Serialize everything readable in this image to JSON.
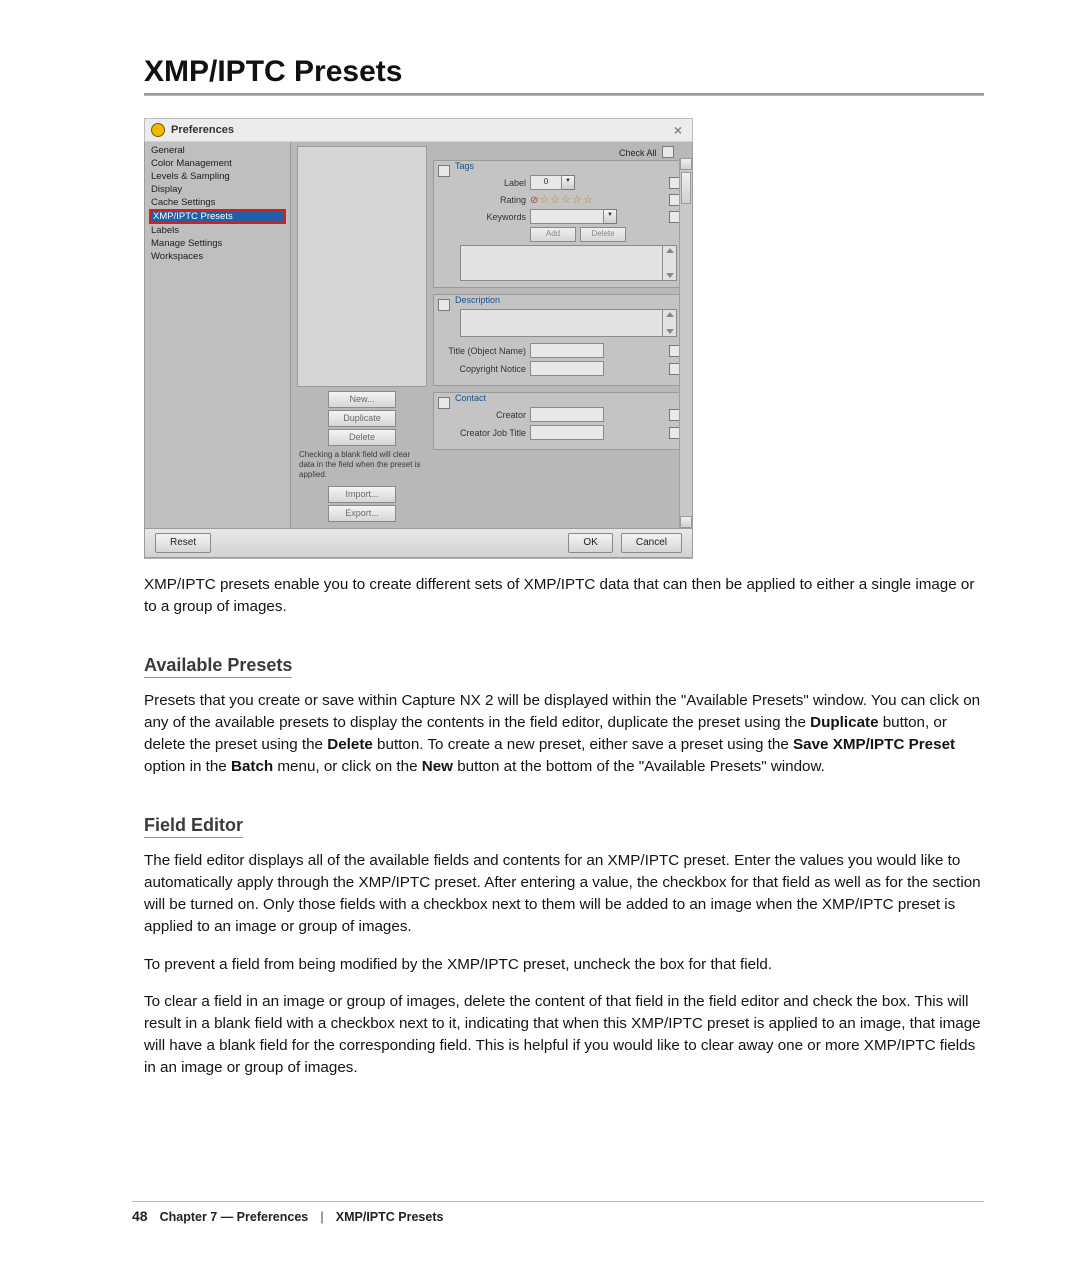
{
  "title": "XMP/IPTC Presets",
  "window": {
    "title": "Preferences",
    "close_x": "×",
    "check_all": "Check All",
    "footer": {
      "reset": "Reset",
      "ok": "OK",
      "cancel": "Cancel"
    }
  },
  "sidebar": {
    "items": [
      {
        "label": "General"
      },
      {
        "label": "Color Management"
      },
      {
        "label": "Levels & Sampling"
      },
      {
        "label": "Display"
      },
      {
        "label": "Cache Settings"
      },
      {
        "label": "XMP/IPTC Presets",
        "selected": true
      },
      {
        "label": "Labels"
      },
      {
        "label": "Manage Settings"
      },
      {
        "label": "Workspaces"
      }
    ]
  },
  "left_buttons": {
    "new": "New...",
    "duplicate": "Duplicate",
    "delete": "Delete",
    "hint": "Checking a blank field will clear data in the field when the preset is applied.",
    "import": "Import...",
    "export": "Export..."
  },
  "panels": {
    "tags": {
      "title": "Tags",
      "label_label": "Label",
      "label_value": "0",
      "rating_label": "Rating",
      "stars": "☆☆☆☆☆",
      "no_rating": "⊘",
      "keywords_label": "Keywords",
      "add_btn": "Add",
      "delete_btn": "Delete"
    },
    "description": {
      "title": "Description",
      "title_field": "Title (Object Name)",
      "copyright_field": "Copyright Notice"
    },
    "contact": {
      "title": "Contact",
      "creator_field": "Creator",
      "creator_job_field": "Creator Job Title"
    }
  },
  "text": {
    "intro": "XMP/IPTC presets enable you to create different sets of XMP/IPTC data that can then be applied to either a single image or to a group of images.",
    "h_available": "Available Presets",
    "available_p1a": "Presets that you create or save within Capture NX 2 will be displayed within the \"Available Presets\" window. You can click on any of the available presets to display the contents in the field editor, duplicate the preset using the ",
    "bold_dup": "Duplicate",
    "available_p1b": " button, or delete the preset using the ",
    "bold_del": "Delete",
    "available_p1c": " button. To create a new preset, either save a preset using the ",
    "bold_save": "Save XMP/IPTC Preset",
    "available_p1d": " option in the ",
    "bold_batch": "Batch",
    "available_p1e": " menu, or click on the ",
    "bold_new": "New",
    "available_p1f": " button at the bottom of the \"Available Presets\" window.",
    "h_field": "Field Editor",
    "field_p1": "The field editor displays all of the available fields and contents for an XMP/IPTC preset. Enter the values you would like to automatically apply through the XMP/IPTC preset. After entering a value, the checkbox for that field as well as for the section will be turned on. Only those fields with a checkbox next to them will be added to an image when the XMP/IPTC preset is applied to an image or group of images.",
    "field_p2": "To prevent a field from being modified by the XMP/IPTC preset, uncheck the box for that field.",
    "field_p3": "To clear a field in an image or group of images, delete the content of that field in the field editor and check the box. This will result in a blank field with a checkbox next to it, indicating that when this XMP/IPTC preset is applied to an image, that image will have a blank field for the corresponding field. This is helpful if you would like to clear away one or more XMP/IPTC fields in an image or group of images."
  },
  "footer": {
    "page": "48",
    "chapter": "Chapter 7 — Preferences",
    "sep": "|",
    "section": "XMP/IPTC Presets"
  }
}
